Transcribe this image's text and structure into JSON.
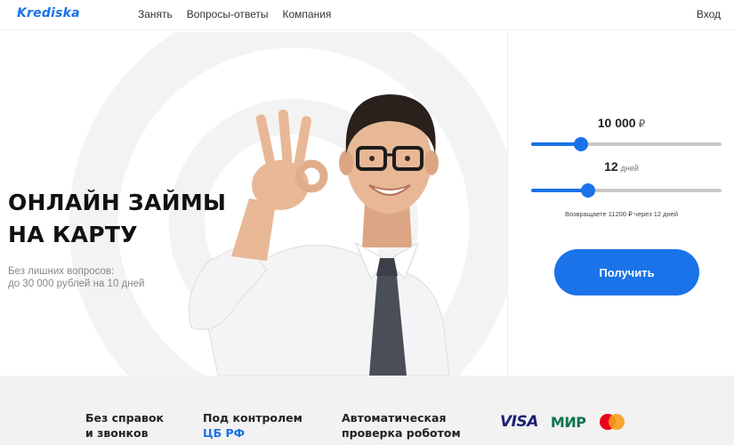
{
  "header": {
    "logo": "Krediska",
    "nav": [
      "Занять",
      "Вопросы-ответы",
      "Компания"
    ],
    "login": "Вход"
  },
  "hero": {
    "title_line1": "ОНЛАЙН ЗАЙМЫ",
    "title_line2": "НА КАРТУ",
    "subtitle_line1": "Без лишних вопросов:",
    "subtitle_line2": "до 30 000 рублей на 10 дней"
  },
  "calculator": {
    "amount": "10 000",
    "currency": "₽",
    "amount_slider_fraction": 0.26,
    "days": "12",
    "days_unit": "дней",
    "days_slider_fraction": 0.3,
    "return_text": "Возвращаете 11200 ₽ через 12 дней",
    "button": "Получить"
  },
  "features": {
    "f1_line1": "Без справок",
    "f1_line2": "и звонков",
    "f2_line1": "Под контролем",
    "f2_line2": "ЦБ РФ",
    "f3_line1": "Автоматическая",
    "f3_line2": "проверка роботом"
  },
  "payments": {
    "visa": "VISA",
    "mir": "МИР",
    "mastercard_label": "mastercard"
  },
  "colors": {
    "accent": "#1a73e8",
    "strip_bg": "#f2f2f2",
    "visa": "#1a1f71",
    "mir": "#0f754e",
    "mc_red": "#eb001b",
    "mc_yellow": "#f79e1b"
  }
}
